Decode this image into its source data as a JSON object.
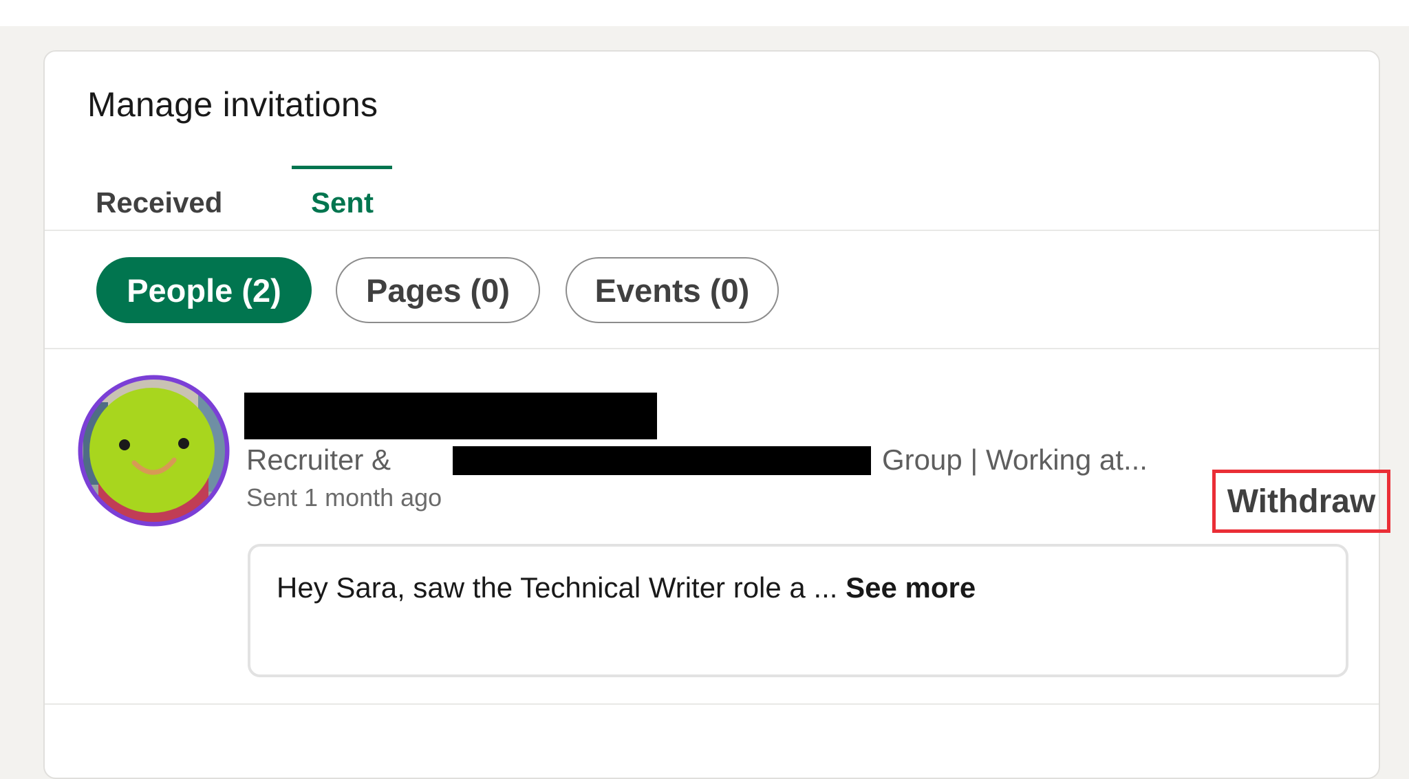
{
  "page": {
    "title": "Manage invitations"
  },
  "tabs": [
    {
      "label": "Received",
      "active": false
    },
    {
      "label": "Sent",
      "active": true
    }
  ],
  "filters": [
    {
      "label": "People (2)",
      "active": true
    },
    {
      "label": "Pages (0)",
      "active": false
    },
    {
      "label": "Events (0)",
      "active": false
    }
  ],
  "invitation": {
    "headline_start": "Recruiter &",
    "headline_end": "Group | Working at...",
    "sent_time": "Sent 1 month ago",
    "withdraw_label": "Withdraw",
    "message": {
      "text": "Hey Sara, saw the Technical Writer role a ...",
      "see_more_label": "See more"
    },
    "avatar_icon": "smiley-avatar-icon"
  },
  "colors": {
    "accent": "#01754f",
    "highlight_outline": "#ea2e36",
    "page_bg": "#f3f2ef",
    "avatar_face": "#a8d61e",
    "avatar_ring": "#7b3fd6"
  }
}
